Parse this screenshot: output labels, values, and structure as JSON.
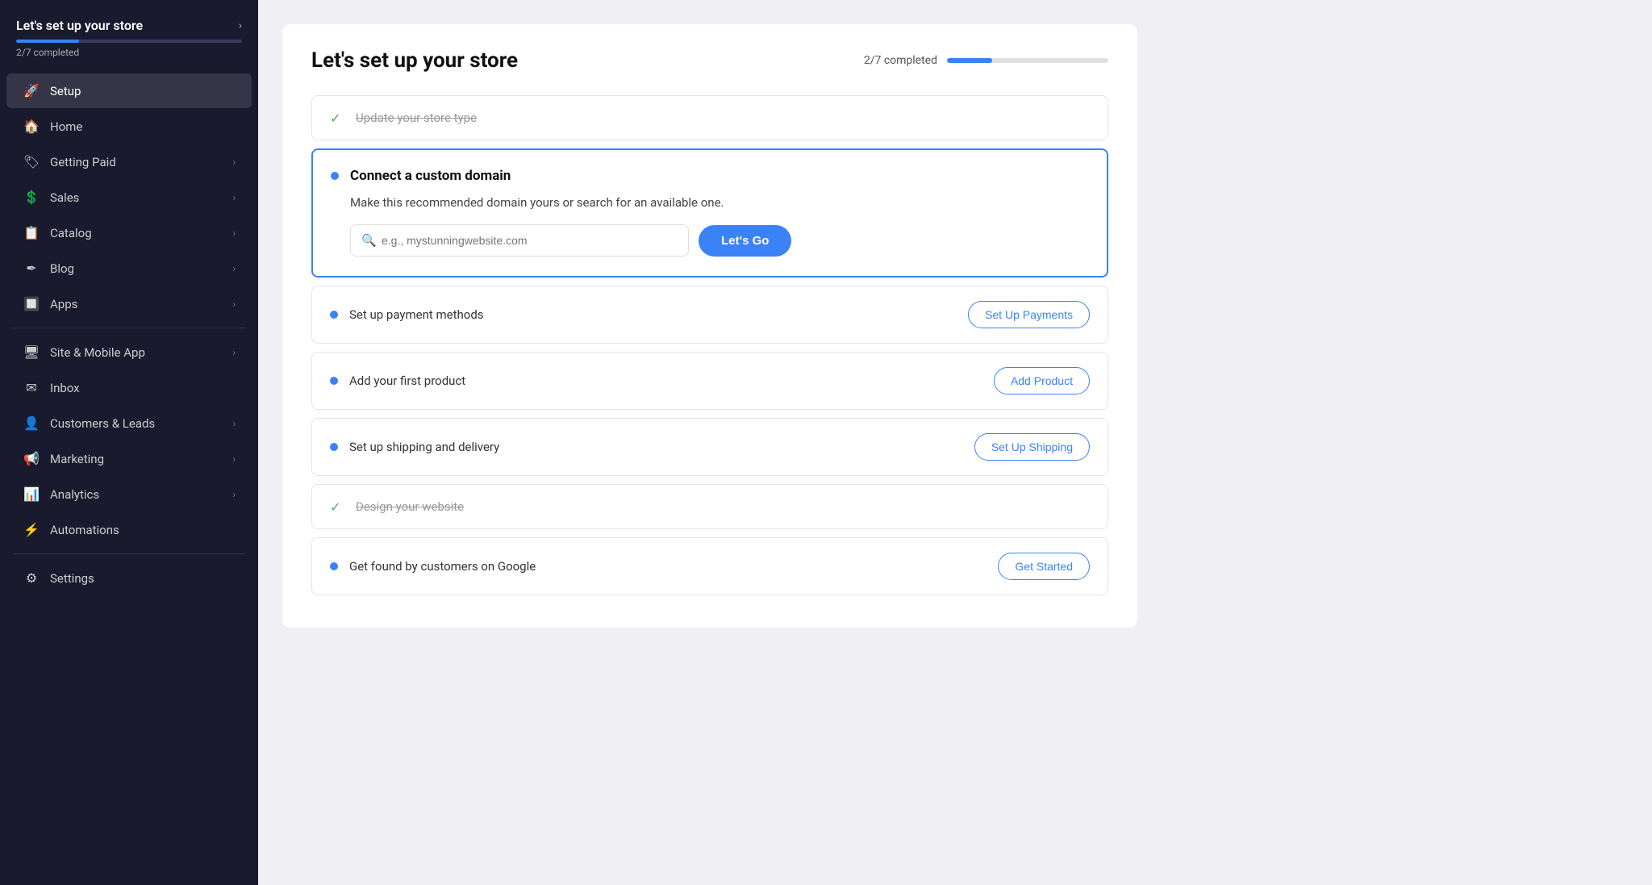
{
  "sidebar": {
    "header_title": "Let's set up your store",
    "progress_label": "2/7 completed",
    "progress_percent": 28,
    "nav_items": [
      {
        "id": "setup",
        "label": "Setup",
        "icon": "🚀",
        "active": true,
        "has_chevron": false
      },
      {
        "id": "home",
        "label": "Home",
        "icon": "🏠",
        "active": false,
        "has_chevron": false
      },
      {
        "id": "getting-paid",
        "label": "Getting Paid",
        "icon": "🏷",
        "active": false,
        "has_chevron": true
      },
      {
        "id": "sales",
        "label": "Sales",
        "icon": "💲",
        "active": false,
        "has_chevron": true
      },
      {
        "id": "catalog",
        "label": "Catalog",
        "icon": "📋",
        "active": false,
        "has_chevron": true
      },
      {
        "id": "blog",
        "label": "Blog",
        "icon": "✒",
        "active": false,
        "has_chevron": true
      },
      {
        "id": "apps",
        "label": "Apps",
        "icon": "🔲",
        "active": false,
        "has_chevron": true
      },
      {
        "divider": true
      },
      {
        "id": "site-mobile-app",
        "label": "Site & Mobile App",
        "icon": "🖥",
        "active": false,
        "has_chevron": true
      },
      {
        "id": "inbox",
        "label": "Inbox",
        "icon": "✉",
        "active": false,
        "has_chevron": false
      },
      {
        "id": "customers-leads",
        "label": "Customers & Leads",
        "icon": "👤",
        "active": false,
        "has_chevron": true
      },
      {
        "id": "marketing",
        "label": "Marketing",
        "icon": "📢",
        "active": false,
        "has_chevron": true
      },
      {
        "id": "analytics",
        "label": "Analytics",
        "icon": "📊",
        "active": false,
        "has_chevron": true
      },
      {
        "id": "automations",
        "label": "Automations",
        "icon": "⚡",
        "active": false,
        "has_chevron": false
      },
      {
        "divider": true
      },
      {
        "id": "settings",
        "label": "Settings",
        "icon": "⚙",
        "active": false,
        "has_chevron": false
      }
    ]
  },
  "main": {
    "card_title": "Let's set up your store",
    "progress_label": "2/7 completed",
    "progress_percent": 28,
    "tasks": [
      {
        "id": "store-type",
        "label": "Update your store type",
        "status": "completed",
        "btn_label": null
      },
      {
        "id": "custom-domain",
        "label": "Connect a custom domain",
        "status": "active",
        "desc": "Make this recommended domain yours or search for an available one.",
        "input_placeholder": "e.g., mystunningwebsite.com",
        "btn_label": "Let's Go"
      },
      {
        "id": "payment",
        "label": "Set up payment methods",
        "status": "pending",
        "btn_label": "Set Up Payments"
      },
      {
        "id": "first-product",
        "label": "Add your first product",
        "status": "pending",
        "btn_label": "Add Product"
      },
      {
        "id": "shipping",
        "label": "Set up shipping and delivery",
        "status": "pending",
        "btn_label": "Set Up Shipping"
      },
      {
        "id": "design",
        "label": "Design your website",
        "status": "completed",
        "btn_label": null
      },
      {
        "id": "google",
        "label": "Get found by customers on Google",
        "status": "pending",
        "btn_label": "Get Started"
      }
    ]
  }
}
